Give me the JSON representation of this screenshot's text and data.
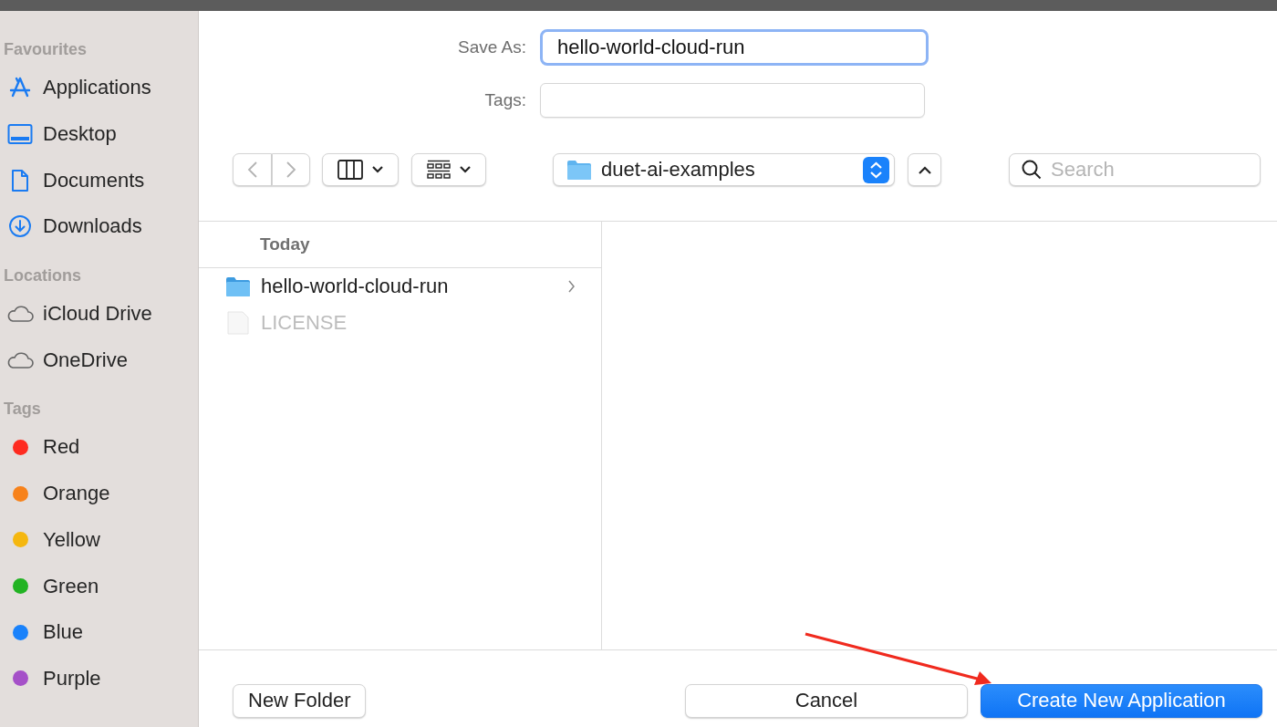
{
  "sidebar": {
    "sections": [
      {
        "title": "Favourites",
        "kind": "places",
        "items": [
          {
            "label": "Applications"
          },
          {
            "label": "Desktop"
          },
          {
            "label": "Documents"
          },
          {
            "label": "Downloads"
          }
        ]
      },
      {
        "title": "Locations",
        "kind": "locations",
        "items": [
          {
            "label": "iCloud Drive"
          },
          {
            "label": "OneDrive"
          }
        ]
      },
      {
        "title": "Tags",
        "kind": "tags",
        "items": [
          {
            "label": "Red",
            "color": "#fe2b20"
          },
          {
            "label": "Orange",
            "color": "#f7821b"
          },
          {
            "label": "Yellow",
            "color": "#f5b70f"
          },
          {
            "label": "Green",
            "color": "#22b323"
          },
          {
            "label": "Blue",
            "color": "#1a82fb"
          },
          {
            "label": "Purple",
            "color": "#a550c8"
          }
        ]
      }
    ]
  },
  "save_as": {
    "label": "Save As:",
    "value": "hello-world-cloud-run"
  },
  "tags_field": {
    "label": "Tags:"
  },
  "location": "duet-ai-examples",
  "search": {
    "placeholder": "Search"
  },
  "browser": {
    "group": "Today",
    "items": [
      {
        "name": "hello-world-cloud-run",
        "kind": "folder",
        "disabled": false
      },
      {
        "name": "LICENSE",
        "kind": "file",
        "disabled": true
      }
    ]
  },
  "buttons": [
    {
      "label": "New Folder",
      "kind": "secondary"
    },
    {
      "label": "Cancel",
      "kind": "secondary"
    },
    {
      "label": "Create New Application",
      "kind": "default"
    }
  ]
}
